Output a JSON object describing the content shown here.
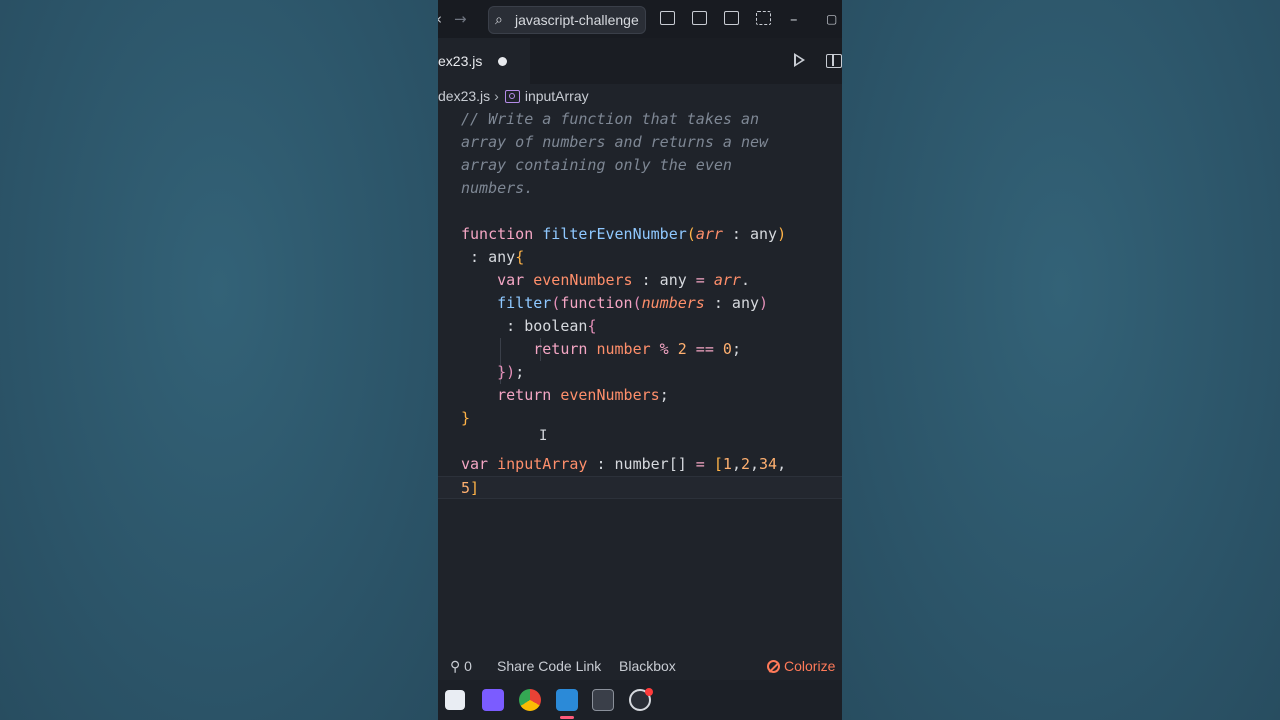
{
  "titlebar": {
    "search_text": "javascript-challenge",
    "back_icon": "arrow-left-icon",
    "forward_icon": "arrow-right-icon",
    "minimize_glyph": "–",
    "maximize_glyph": "▢"
  },
  "tab": {
    "label": "ex23.js",
    "modified": true
  },
  "breadcrumb": {
    "file": "dex23.js",
    "separator": "›",
    "symbol": "inputArray"
  },
  "code_lines": [
    [
      {
        "t": "// Write a function that takes an",
        "c": "cm"
      }
    ],
    [
      {
        "t": "array of numbers and returns a new",
        "c": "cm"
      }
    ],
    [
      {
        "t": "array containing only the even",
        "c": "cm"
      }
    ],
    [
      {
        "t": "numbers.",
        "c": "cm"
      }
    ],
    [],
    [
      {
        "t": "function ",
        "c": "kw"
      },
      {
        "t": "filterEvenNumber",
        "c": "fn"
      },
      {
        "t": "(",
        "c": "br"
      },
      {
        "t": "arr",
        "c": "pa"
      },
      {
        "t": " : any",
        "c": "ty"
      },
      {
        "t": ")",
        "c": "br"
      }
    ],
    [
      {
        "t": " : any",
        "c": "ty"
      },
      {
        "t": "{",
        "c": "br"
      }
    ],
    [
      {
        "t": "    var ",
        "c": "kw"
      },
      {
        "t": "evenNumbers",
        "c": "va"
      },
      {
        "t": " : any",
        "c": "ty"
      },
      {
        "t": " = ",
        "c": "op"
      },
      {
        "t": "arr",
        "c": "pa"
      },
      {
        "t": ".",
        "c": "pl"
      }
    ],
    [
      {
        "t": "    filter",
        "c": "fn"
      },
      {
        "t": "(",
        "c": "bp"
      },
      {
        "t": "function",
        "c": "kw"
      },
      {
        "t": "(",
        "c": "bp"
      },
      {
        "t": "numbers",
        "c": "pa"
      },
      {
        "t": " : any",
        "c": "ty"
      },
      {
        "t": ")",
        "c": "bp"
      }
    ],
    [
      {
        "t": "     : boolean",
        "c": "ty"
      },
      {
        "t": "{",
        "c": "bp"
      }
    ],
    [
      {
        "t": "        return ",
        "c": "kw"
      },
      {
        "t": "number",
        "c": "va"
      },
      {
        "t": " % ",
        "c": "op"
      },
      {
        "t": "2",
        "c": "nu"
      },
      {
        "t": " == ",
        "c": "op"
      },
      {
        "t": "0",
        "c": "nu"
      },
      {
        "t": ";",
        "c": "pl"
      }
    ],
    [
      {
        "t": "    ",
        "c": "pl"
      },
      {
        "t": "})",
        "c": "bp"
      },
      {
        "t": ";",
        "c": "pl"
      }
    ],
    [
      {
        "t": "    return ",
        "c": "kw"
      },
      {
        "t": "evenNumbers",
        "c": "va"
      },
      {
        "t": ";",
        "c": "pl"
      }
    ],
    [
      {
        "t": "}",
        "c": "br"
      }
    ],
    [],
    [
      {
        "t": "var ",
        "c": "kw"
      },
      {
        "t": "inputArray",
        "c": "va"
      },
      {
        "t": " : number[]",
        "c": "ty"
      },
      {
        "t": " = ",
        "c": "op"
      },
      {
        "t": "[",
        "c": "bm"
      },
      {
        "t": "1",
        "c": "nu"
      },
      {
        "t": ",",
        "c": "pl"
      },
      {
        "t": "2",
        "c": "nu"
      },
      {
        "t": ",",
        "c": "pl"
      },
      {
        "t": "34",
        "c": "nu"
      },
      {
        "t": ",",
        "c": "pl"
      }
    ],
    [
      {
        "t": "5",
        "c": "nu"
      },
      {
        "t": "]",
        "c": "bm"
      }
    ]
  ],
  "current_line_index": 16,
  "statusbar": {
    "ports": "0",
    "share": "Share Code Link",
    "blackbox": "Blackbox",
    "colorize": "Colorize"
  },
  "taskbar": {
    "icons": [
      "start-icon",
      "clapper-icon",
      "chrome-icon",
      "vscode-icon",
      "terminal-icon",
      "obs-icon"
    ]
  },
  "colors": {
    "editor_bg": "#1f232a",
    "desktop_bg": "#2f5a6e",
    "accent_orange": "#ff7a59"
  }
}
